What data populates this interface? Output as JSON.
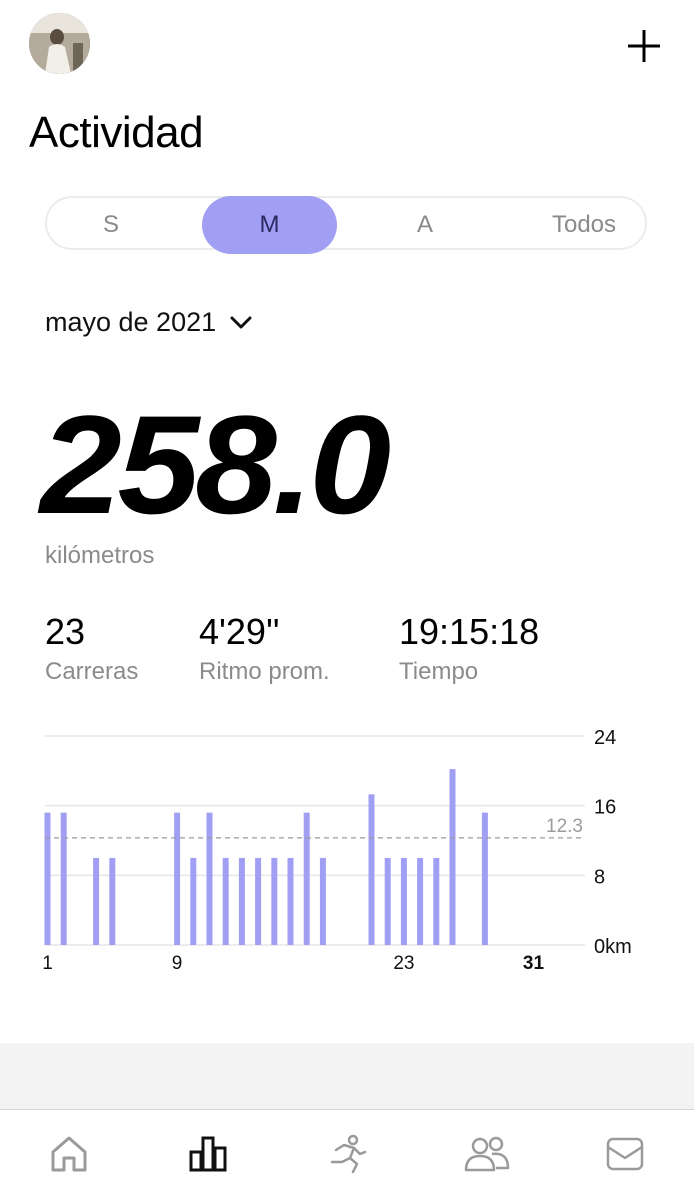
{
  "header": {
    "title": "Actividad",
    "add_icon": "plus-icon",
    "avatar_icon": "user-avatar"
  },
  "period_tabs": [
    {
      "label": "S",
      "selected": false
    },
    {
      "label": "M",
      "selected": true
    },
    {
      "label": "A",
      "selected": false
    },
    {
      "label": "Todos",
      "selected": false
    }
  ],
  "date_selector": {
    "label": "mayo de 2021",
    "icon": "chevron-down-icon"
  },
  "summary": {
    "distance": "258.0",
    "unit": "kilómetros"
  },
  "stats": [
    {
      "value": "23",
      "label": "Carreras"
    },
    {
      "value": "4'29''",
      "label": "Ritmo prom."
    },
    {
      "value": "19:15:18",
      "label": "Tiempo"
    }
  ],
  "chart_data": {
    "type": "bar",
    "x_tick_labels": [
      "1",
      "9",
      "23",
      "31"
    ],
    "y_tick_labels": [
      "24",
      "16",
      "8",
      "0km"
    ],
    "ylim": [
      0,
      24
    ],
    "average_line": {
      "value": 12.3,
      "label": "12.3"
    },
    "bars": [
      {
        "day": 1,
        "value": 15.2
      },
      {
        "day": 2,
        "value": 15.2
      },
      {
        "day": 4,
        "value": 10
      },
      {
        "day": 5,
        "value": 10
      },
      {
        "day": 9,
        "value": 15.2
      },
      {
        "day": 10,
        "value": 10
      },
      {
        "day": 11,
        "value": 15.2
      },
      {
        "day": 12,
        "value": 10
      },
      {
        "day": 13,
        "value": 10
      },
      {
        "day": 14,
        "value": 10
      },
      {
        "day": 15,
        "value": 10
      },
      {
        "day": 16,
        "value": 10
      },
      {
        "day": 17,
        "value": 15.2
      },
      {
        "day": 18,
        "value": 10
      },
      {
        "day": 21,
        "value": 17.3
      },
      {
        "day": 22,
        "value": 10
      },
      {
        "day": 23,
        "value": 10
      },
      {
        "day": 24,
        "value": 10
      },
      {
        "day": 25,
        "value": 10
      },
      {
        "day": 26,
        "value": 20.2
      },
      {
        "day": 28,
        "value": 15.2
      }
    ],
    "bar_color": "#a19ff3",
    "grid": true
  },
  "tabbar": [
    {
      "icon": "home-icon",
      "selected": false
    },
    {
      "icon": "bar-chart-icon",
      "selected": true
    },
    {
      "icon": "running-icon",
      "selected": false
    },
    {
      "icon": "community-icon",
      "selected": false
    },
    {
      "icon": "mail-icon",
      "selected": false
    }
  ],
  "colors": {
    "accent": "#a19ff3",
    "muted_text": "#8b8b8b"
  }
}
